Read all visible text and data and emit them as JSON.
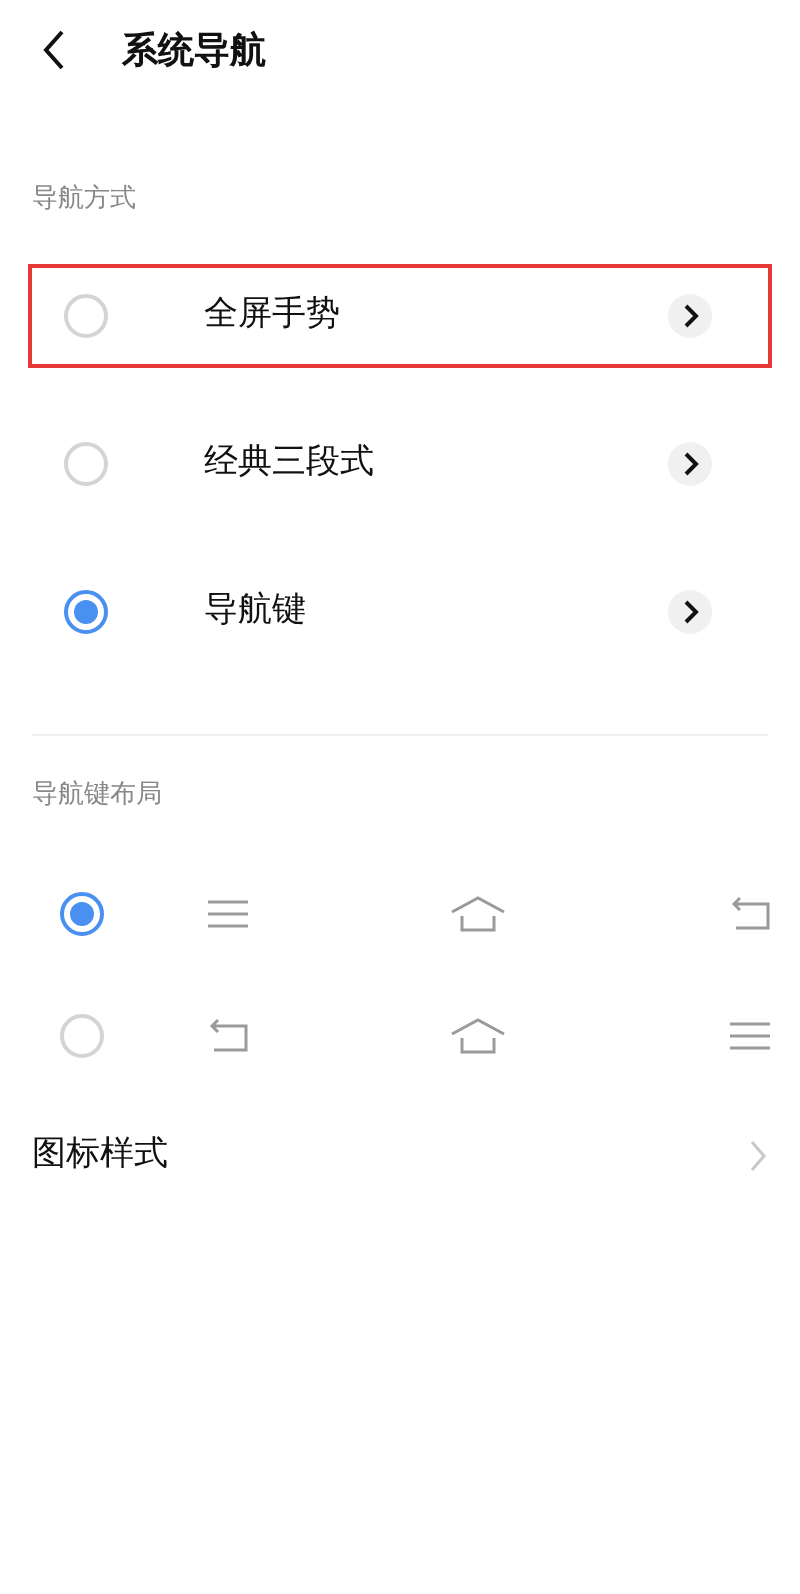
{
  "header": {
    "title": "系统导航"
  },
  "nav_mode": {
    "label": "导航方式",
    "options": [
      {
        "label": "全屏手势",
        "selected": false,
        "highlighted": true
      },
      {
        "label": "经典三段式",
        "selected": false,
        "highlighted": false
      },
      {
        "label": "导航键",
        "selected": true,
        "highlighted": false
      }
    ]
  },
  "key_layout": {
    "label": "导航键布局",
    "options": [
      {
        "selected": true,
        "keys": [
          {
            "kind": "menu"
          },
          {
            "kind": "home"
          },
          {
            "kind": "back"
          }
        ]
      },
      {
        "selected": false,
        "keys": [
          {
            "kind": "back"
          },
          {
            "kind": "home"
          },
          {
            "kind": "menu"
          }
        ]
      }
    ]
  },
  "icon_style": {
    "label": "图标样式"
  }
}
